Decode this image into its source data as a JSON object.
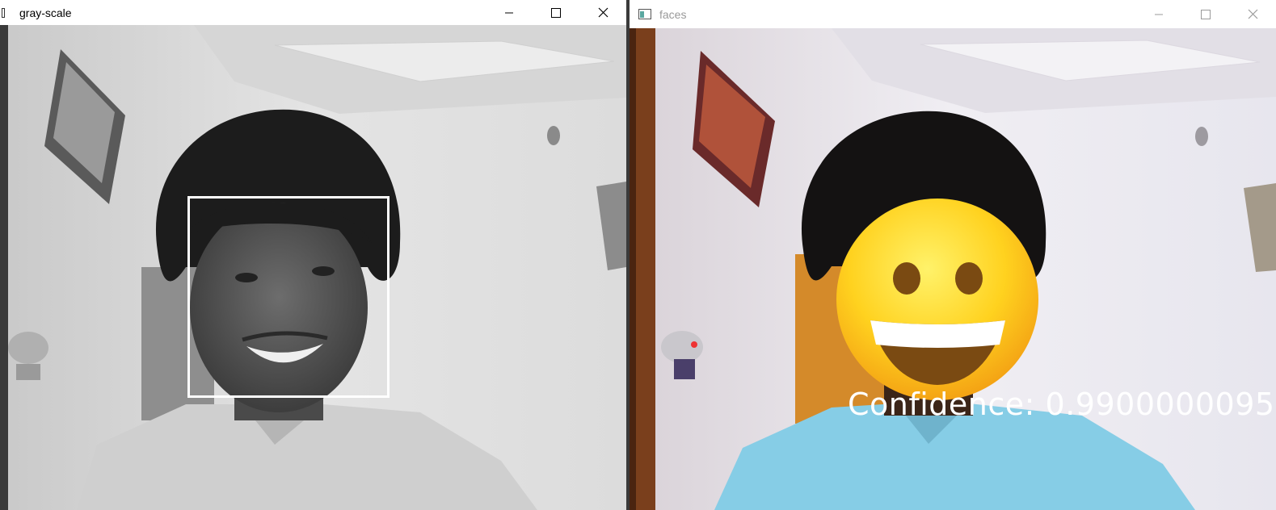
{
  "windows": {
    "left": {
      "title": "gray-scale"
    },
    "right": {
      "title": "faces",
      "overlay_text": "Confidence: 0.9900000095"
    }
  },
  "icons": {
    "minimize": "minimize-icon",
    "maximize": "maximize-icon",
    "close": "close-icon",
    "app": "app-window-icon",
    "emoji": "grinning-face-emoji-icon"
  },
  "colors": {
    "face_box": "#ffffff",
    "confidence_text": "#ffffff",
    "emoji_yellow": "#ffd21f",
    "shirt_blue": "#86cde6"
  }
}
